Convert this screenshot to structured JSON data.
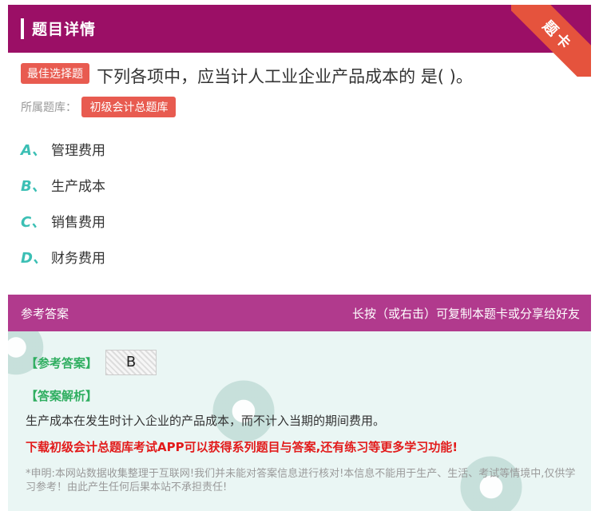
{
  "header": {
    "title": "题目详情",
    "corner_label": "题卡"
  },
  "question": {
    "type_tag": "最佳选择题",
    "text": "下列各项中，应当计人工业企业产品成本的 是( )。",
    "library_label": "所属题库：",
    "library_name": "初级会计总题库"
  },
  "options": [
    {
      "letter": "A、",
      "text": "管理费用"
    },
    {
      "letter": "B、",
      "text": "生产成本"
    },
    {
      "letter": "C、",
      "text": "销售费用"
    },
    {
      "letter": "D、",
      "text": "财务费用"
    }
  ],
  "answer_section": {
    "title": "参考答案",
    "hint": "长按（或右击）可复制本题卡或分享给好友",
    "ref_label": "【参考答案】",
    "ref_value": "B",
    "analysis_label": "【答案解析】",
    "analysis_text": "生产成本在发生时计入企业的产品成本，而不计入当期的期间费用。",
    "promo_text": "下载初级会计总题库考试APP可以获得系列题目与答案,还有练习等更多学习功能!",
    "disclaimer": "*申明:本网站数据收集整理于互联网!我们并未能对答案信息进行核对!本信息不能用于生产、生活、考试等情境中,仅供学习参考！由此产生任何后果本站不承担责任!"
  },
  "colors": {
    "header_bg": "#9b0f66",
    "answer_header_bg": "#b13a8d",
    "tag_bg": "#e85b50",
    "option_letter": "#3bbfb4",
    "label_green": "#2fae60",
    "promo_red": "#e21b1b",
    "answer_body_bg": "#eaf6f4"
  }
}
